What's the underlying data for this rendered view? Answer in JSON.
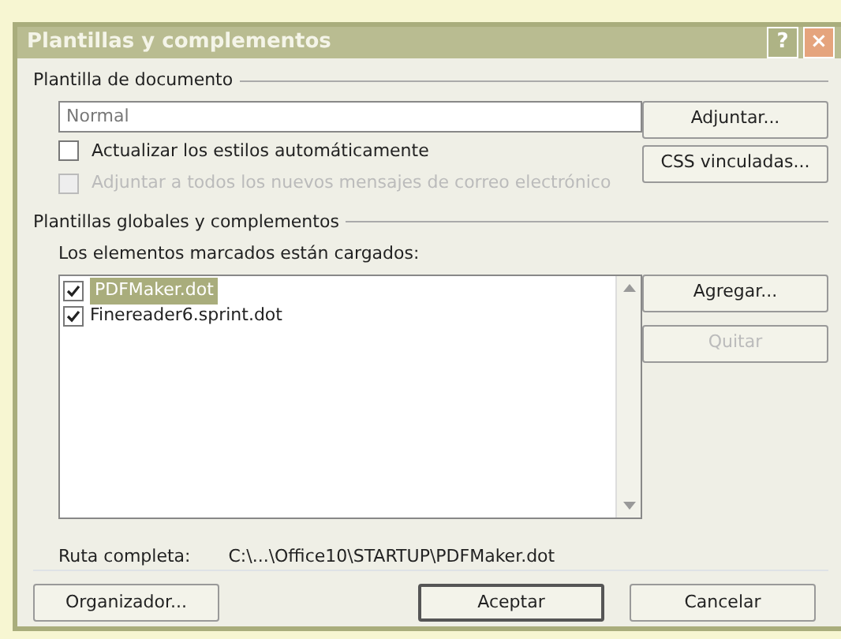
{
  "window": {
    "title": "Plantillas y complementos",
    "help_button": "?",
    "close_button": "×"
  },
  "document_template": {
    "label": "Plantilla de documento",
    "value": "Normal",
    "buttons": [
      {
        "label": "Adjuntar...",
        "disabled": false
      },
      {
        "label": "CSS vinculadas...",
        "disabled": false
      }
    ],
    "options": [
      {
        "label": "Actualizar los estilos automáticamente",
        "checked": false,
        "disabled": false
      },
      {
        "label": "Adjuntar a todos los nuevos mensajes de correo electrónico",
        "checked": false,
        "disabled": true
      }
    ]
  },
  "global_templates": {
    "label": "Plantillas globales y complementos",
    "hint": "Los elementos marcados están cargados:",
    "items": [
      {
        "name": "PDFMaker.dot",
        "checked": true,
        "selected": true
      },
      {
        "name": "Finereader6.sprint.dot",
        "checked": true,
        "selected": false
      }
    ],
    "buttons": [
      {
        "label": "Agregar...",
        "disabled": false
      },
      {
        "label": "Quitar",
        "disabled": true
      }
    ],
    "path_label": "Ruta completa:",
    "path": "C:\\...\\Office10\\STARTUP\\PDFMaker.dot"
  },
  "footer_buttons": [
    {
      "label": "Organizador...",
      "default": false
    },
    {
      "label": "Aceptar",
      "default": true
    },
    {
      "label": "Cancelar",
      "default": false
    }
  ]
}
